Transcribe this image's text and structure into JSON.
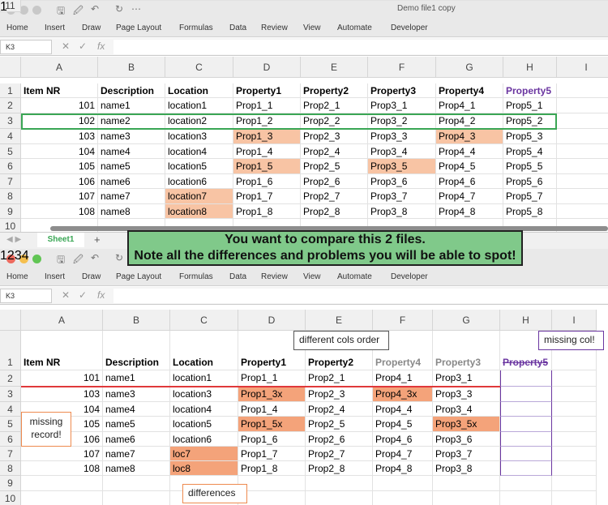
{
  "colors": {
    "highlight_light": "#f8c4a4",
    "highlight_strong": "#f4a37a",
    "accent_green": "#3aa655",
    "purple": "#6a35a0",
    "gray": "#8c8c8c",
    "orange": "#ee8a4f",
    "red": "#e0383a"
  },
  "ribbon_tabs": [
    "Home",
    "Insert",
    "Draw",
    "Page Layout",
    "Formulas",
    "Data",
    "Review",
    "View",
    "Automate",
    "Developer"
  ],
  "top": {
    "title": "Demo file1 copy",
    "namebox": "K3",
    "sheet_tab": "Sheet1",
    "add_sheet": "+",
    "columns": [
      "A",
      "B",
      "C",
      "D",
      "E",
      "F",
      "G",
      "H",
      "I"
    ],
    "rows": [
      [
        "Item NR",
        "Description",
        "Location",
        "Property1",
        "Property2",
        "Property3",
        "Property4",
        "Property5"
      ],
      [
        "101",
        "name1",
        "location1",
        "Prop1_1",
        "Prop2_1",
        "Prop3_1",
        "Prop4_1",
        "Prop5_1"
      ],
      [
        "102",
        "name2",
        "location2",
        "Prop1_2",
        "Prop2_2",
        "Prop3_2",
        "Prop4_2",
        "Prop5_2"
      ],
      [
        "103",
        "name3",
        "location3",
        "Prop1_3",
        "Prop2_3",
        "Prop3_3",
        "Prop4_3",
        "Prop5_3"
      ],
      [
        "104",
        "name4",
        "location4",
        "Prop1_4",
        "Prop2_4",
        "Prop3_4",
        "Prop4_4",
        "Prop5_4"
      ],
      [
        "105",
        "name5",
        "location5",
        "Prop1_5",
        "Prop2_5",
        "Prop3_5",
        "Prop4_5",
        "Prop5_5"
      ],
      [
        "106",
        "name6",
        "location6",
        "Prop1_6",
        "Prop2_6",
        "Prop3_6",
        "Prop4_6",
        "Prop5_6"
      ],
      [
        "107",
        "name7",
        "location7",
        "Prop1_7",
        "Prop2_7",
        "Prop3_7",
        "Prop4_7",
        "Prop5_7"
      ],
      [
        "108",
        "name8",
        "location8",
        "Prop1_8",
        "Prop2_8",
        "Prop3_8",
        "Prop4_8",
        "Prop5_8"
      ],
      [],
      []
    ],
    "highlights": [
      [
        3,
        3
      ],
      [
        3,
        6
      ],
      [
        5,
        3
      ],
      [
        5,
        5
      ],
      [
        7,
        2
      ],
      [
        8,
        2
      ]
    ],
    "badge": "1"
  },
  "banner": {
    "line1": "You want to compare this 2 files.",
    "line2": "Note all the differences and problems you will be able to spot!"
  },
  "bottom": {
    "namebox": "K3",
    "columns": [
      "A",
      "B",
      "C",
      "D",
      "E",
      "F",
      "G",
      "H",
      "I"
    ],
    "rows": [
      [
        "Item NR",
        "Description",
        "Location",
        "Property1",
        "Property2",
        "Property4",
        "Property3",
        "Property5"
      ],
      [
        "101",
        "name1",
        "location1",
        "Prop1_1",
        "Prop2_1",
        "Prop4_1",
        "Prop3_1",
        ""
      ],
      [
        "103",
        "name3",
        "location3",
        "Prop1_3x",
        "Prop2_3",
        "Prop4_3x",
        "Prop3_3",
        ""
      ],
      [
        "104",
        "name4",
        "location4",
        "Prop1_4",
        "Prop2_4",
        "Prop4_4",
        "Prop3_4",
        ""
      ],
      [
        "105",
        "name5",
        "location5",
        "Prop1_5x",
        "Prop2_5",
        "Prop4_5",
        "Prop3_5x",
        ""
      ],
      [
        "106",
        "name6",
        "location6",
        "Prop1_6",
        "Prop2_6",
        "Prop4_6",
        "Prop3_6",
        ""
      ],
      [
        "107",
        "name7",
        "loc7",
        "Prop1_7",
        "Prop2_7",
        "Prop4_7",
        "Prop3_7",
        ""
      ],
      [
        "108",
        "name8",
        "loc8",
        "Prop1_8",
        "Prop2_8",
        "Prop4_8",
        "Prop3_8",
        ""
      ],
      [],
      []
    ],
    "highlights": [
      [
        2,
        3
      ],
      [
        2,
        5
      ],
      [
        4,
        3
      ],
      [
        4,
        6
      ],
      [
        6,
        2
      ],
      [
        7,
        2
      ]
    ],
    "annotations": {
      "missing_record": "missing\nrecord!",
      "differences": "differences",
      "cols_order": "different cols order",
      "missing_col": "missing col!"
    },
    "badges": [
      "1",
      "2",
      "3",
      "4"
    ]
  }
}
